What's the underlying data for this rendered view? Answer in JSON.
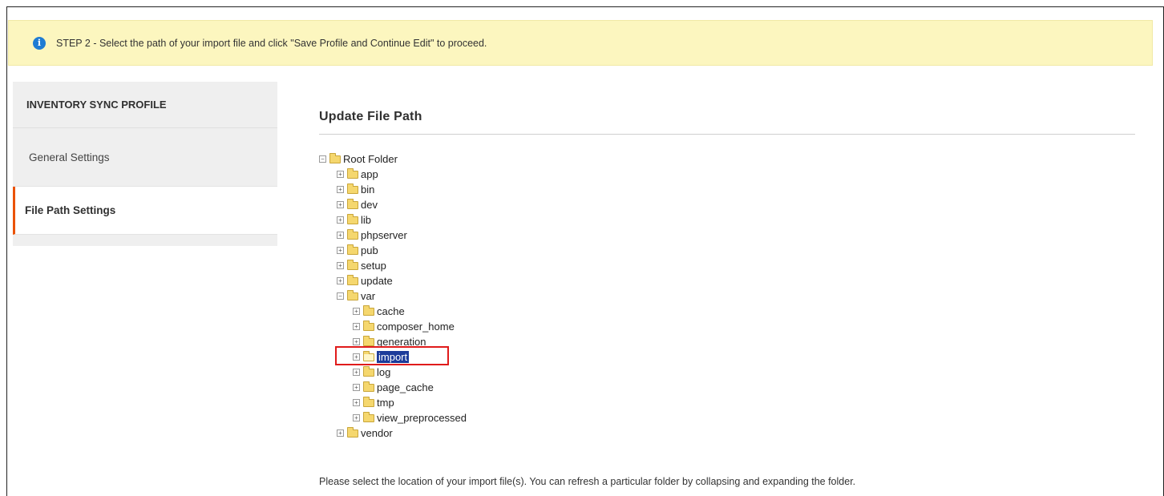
{
  "notice": {
    "icon": "info-icon",
    "text": "STEP 2 - Select the path of your import file and click \"Save Profile and Continue Edit\" to proceed."
  },
  "sidebar": {
    "heading": "INVENTORY SYNC PROFILE",
    "items": [
      {
        "label": "General Settings",
        "active": false
      },
      {
        "label": "File Path Settings",
        "active": true
      }
    ]
  },
  "main": {
    "title": "Update File Path",
    "help_text": "Please select the location of your import file(s). You can refresh a particular folder by collapsing and expanding the folder."
  },
  "tree": {
    "root": "Root Folder",
    "nodes": [
      {
        "label": "app"
      },
      {
        "label": "bin"
      },
      {
        "label": "dev"
      },
      {
        "label": "lib"
      },
      {
        "label": "phpserver"
      },
      {
        "label": "pub"
      },
      {
        "label": "setup"
      },
      {
        "label": "update"
      },
      {
        "label": "var"
      },
      {
        "label": "cache"
      },
      {
        "label": "composer_home"
      },
      {
        "label": "generation"
      },
      {
        "label": "import"
      },
      {
        "label": "log"
      },
      {
        "label": "page_cache"
      },
      {
        "label": "tmp"
      },
      {
        "label": "view_preprocessed"
      },
      {
        "label": "vendor"
      }
    ],
    "selected": "import"
  },
  "colors": {
    "notice_bg": "#fcf6bf",
    "info_icon": "#1f7cd3",
    "active_accent": "#eb5202",
    "selection": "#1c3b9a",
    "highlight_box": "#e01b1b"
  }
}
